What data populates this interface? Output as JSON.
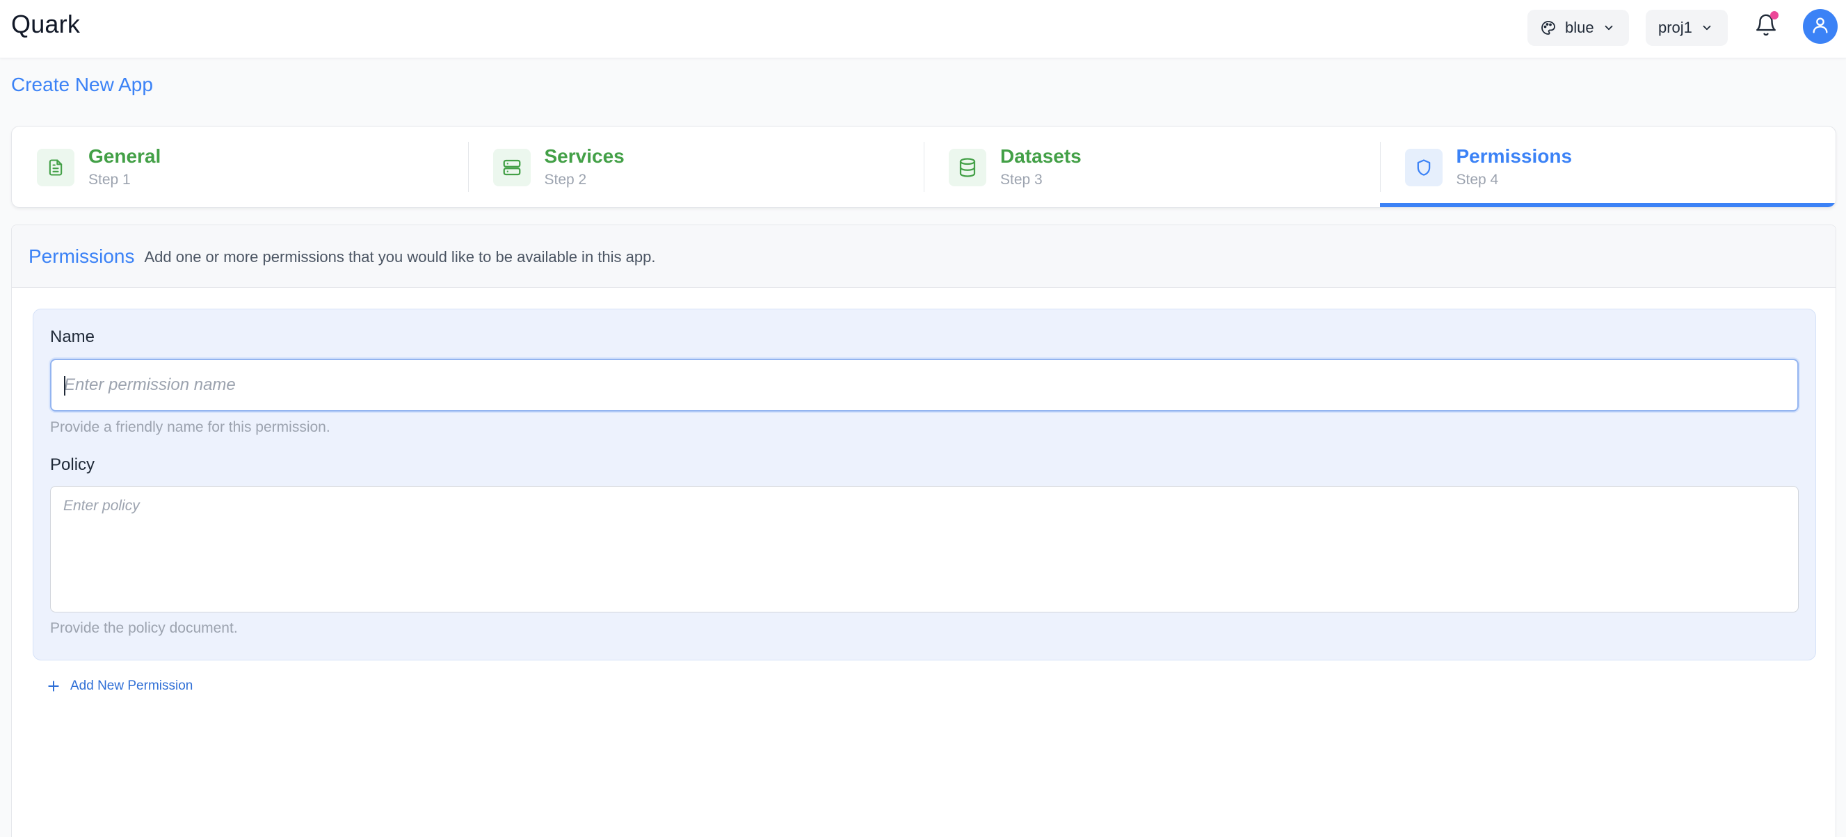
{
  "app": {
    "brand": "Quark"
  },
  "header": {
    "theme": {
      "label": "blue",
      "icon": "palette-icon"
    },
    "project": {
      "label": "proj1"
    },
    "notifications": {
      "icon": "bell-icon",
      "has_unread": true
    },
    "user": {
      "icon": "user-icon"
    }
  },
  "page": {
    "title": "Create New App"
  },
  "stepper": {
    "active_index": 3,
    "steps": [
      {
        "title": "General",
        "sub": "Step 1",
        "icon": "document-icon",
        "status": "complete"
      },
      {
        "title": "Services",
        "sub": "Step 2",
        "icon": "server-icon",
        "status": "complete"
      },
      {
        "title": "Datasets",
        "sub": "Step 3",
        "icon": "database-icon",
        "status": "complete"
      },
      {
        "title": "Permissions",
        "sub": "Step 4",
        "icon": "shield-icon",
        "status": "active"
      }
    ]
  },
  "permissions": {
    "title": "Permissions",
    "description": "Add one or more permissions that you would like to be available in this app.",
    "name": {
      "label": "Name",
      "value": "",
      "placeholder": "Enter permission name",
      "help": "Provide a friendly name for this permission."
    },
    "policy": {
      "label": "Policy",
      "value": "",
      "placeholder": "Enter policy",
      "help": "Provide the policy document."
    },
    "add_label": "Add New Permission"
  },
  "colors": {
    "accent": "#3b82f6",
    "complete": "#43a047",
    "notification_dot": "#ec4899",
    "card_bg": "#edf2fd"
  }
}
